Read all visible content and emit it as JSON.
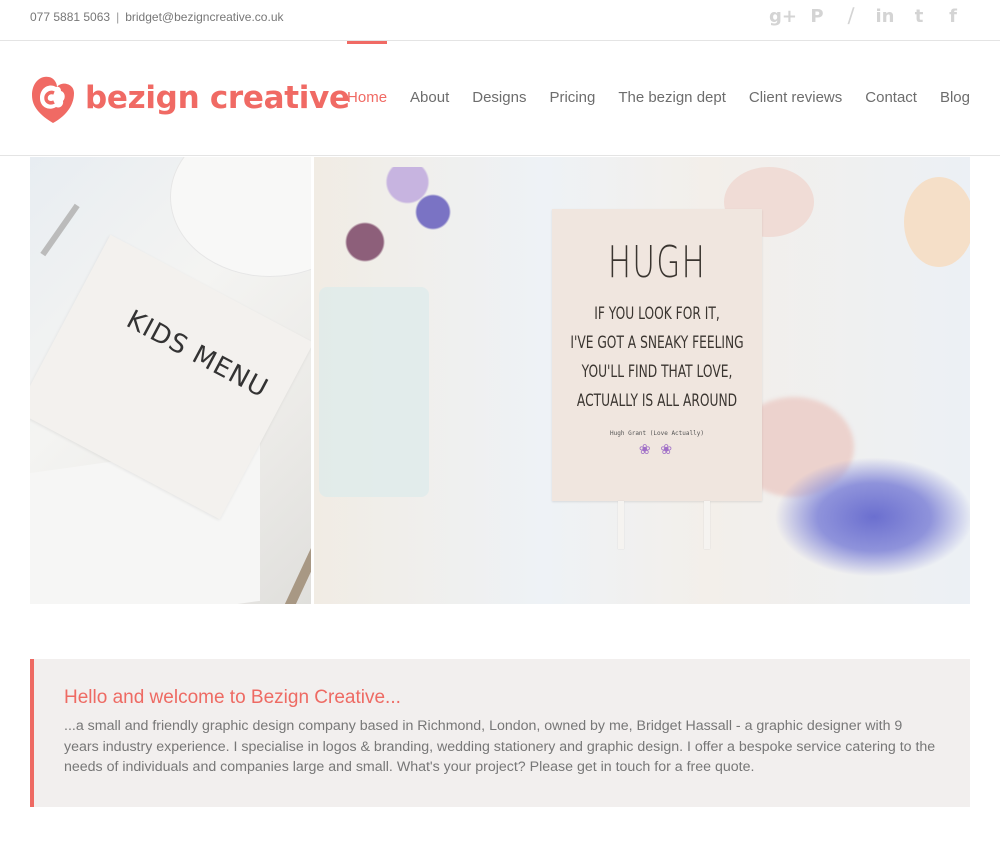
{
  "topbar": {
    "phone": "077 5881 5063",
    "separator": "|",
    "email": "bridget@bezigncreative.co.uk",
    "social": [
      {
        "name": "google-plus-icon",
        "glyph": "g+"
      },
      {
        "name": "pinterest-icon",
        "glyph": "P"
      },
      {
        "name": "rss-icon",
        "glyph": "Ω"
      },
      {
        "name": "linkedin-icon",
        "glyph": "in"
      },
      {
        "name": "twitter-icon",
        "glyph": "t"
      },
      {
        "name": "facebook-icon",
        "glyph": "f"
      }
    ]
  },
  "header": {
    "logo_text": "bezign creative",
    "brand_color": "#f06a64",
    "nav": [
      {
        "label": "Home",
        "active": true
      },
      {
        "label": "About",
        "active": false
      },
      {
        "label": "Designs",
        "active": false
      },
      {
        "label": "Pricing",
        "active": false
      },
      {
        "label": "The bezign dept",
        "active": false
      },
      {
        "label": "Client reviews",
        "active": false
      },
      {
        "label": "Contact",
        "active": false
      },
      {
        "label": "Blog",
        "active": false
      }
    ]
  },
  "hero": {
    "left_image": {
      "card_title": "KIDS MENU"
    },
    "right_image": {
      "sign_name": "HUGH",
      "sign_quote": [
        "If you look for it,",
        "I've got a sneaky feeling",
        "you'll find that love,",
        "actually is all around"
      ],
      "sign_credit": "Hugh Grant (Love Actually)"
    }
  },
  "welcome": {
    "heading": "Hello and welcome to Bezign Creative...",
    "body": "...a small and friendly graphic design company based in Richmond, London, owned by me, Bridget Hassall - a graphic designer with 9 years industry experience. I specialise in logos & branding, wedding stationery and graphic design. I offer a bespoke service catering to the needs of individuals and companies large and small. What's your project? Please get in touch for a free quote.",
    "accent_color": "#ee6a63"
  }
}
